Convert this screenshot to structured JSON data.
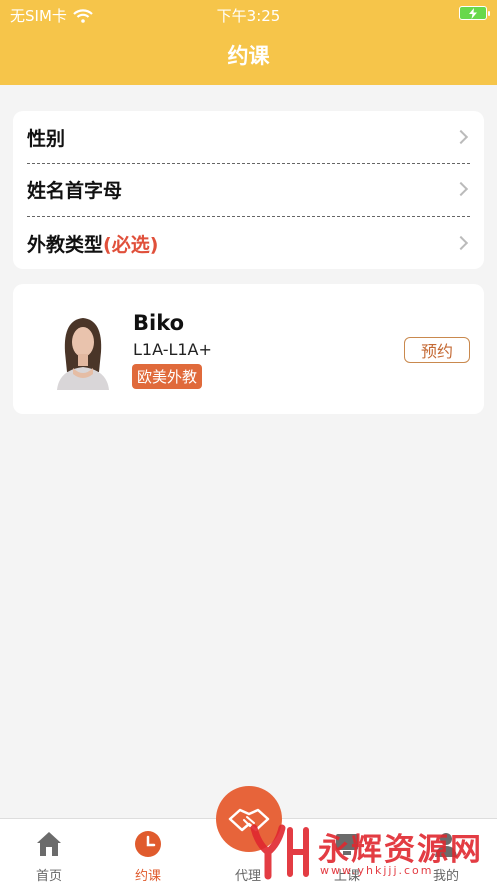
{
  "status_bar": {
    "carrier": "无SIM卡",
    "time": "下午3:25"
  },
  "header": {
    "title": "约课"
  },
  "filters": [
    {
      "label": "性别",
      "required_note": ""
    },
    {
      "label": "姓名首字母",
      "required_note": ""
    },
    {
      "label": "外教类型",
      "required_note": "(必选)"
    }
  ],
  "teacher": {
    "name": "Biko",
    "level": "L1A-L1A+",
    "tag": "欧美外教",
    "book_label": "预约"
  },
  "tabs": [
    {
      "label": "首页",
      "icon": "home-icon",
      "active": false
    },
    {
      "label": "约课",
      "icon": "clock-icon",
      "active": true
    },
    {
      "label": "代理",
      "icon": "handshake-icon",
      "active": false
    },
    {
      "label": "上课",
      "icon": "class-icon",
      "active": false
    },
    {
      "label": "我的",
      "icon": "user-icon",
      "active": false
    }
  ],
  "watermark": {
    "text": "永辉资源网",
    "url": "www.yhkjjj.com"
  },
  "colors": {
    "header": "#f6c54a",
    "accent": "#e7643a",
    "tag": "#e06a3b",
    "required": "#e0503b"
  }
}
